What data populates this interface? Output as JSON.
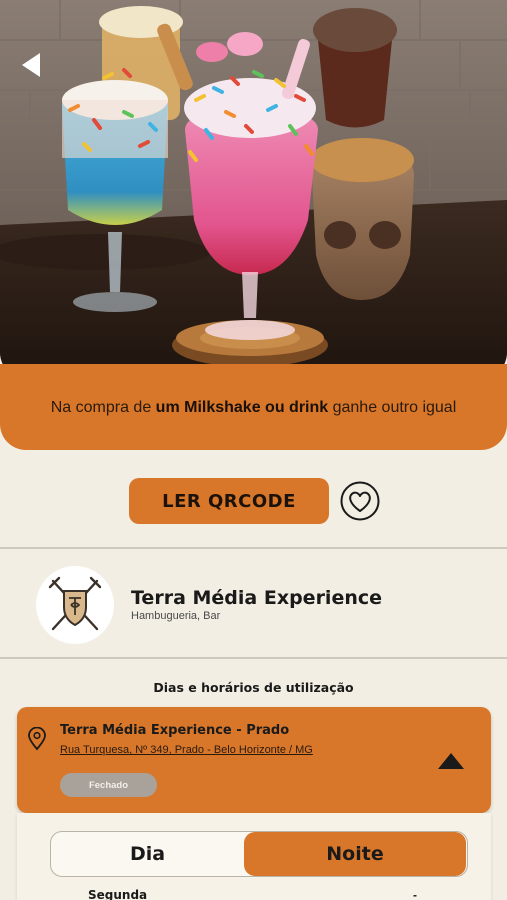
{
  "colors": {
    "accent": "#d8772a",
    "background": "#f3eee3",
    "status_closed": "#a8a29a"
  },
  "hero": {
    "back_icon": "back-arrow-icon"
  },
  "promo": {
    "prefix": "Na compra de ",
    "bold": "um Milkshake ou drink",
    "suffix": " ganhe outro igual"
  },
  "actions": {
    "qr_label": "LER QRCODE",
    "favorite_icon": "heart-icon"
  },
  "venue": {
    "name": "Terra Média Experience",
    "categories": "Hambugueria, Bar",
    "logo_icon": "crossed-swords-shield-logo"
  },
  "schedule": {
    "section_title": "Dias e horários de utilização",
    "location": {
      "title": "Terra Média Experience - Prado",
      "address": "Rua Turquesa, Nº 349, Prado - Belo Horizonte / MG",
      "status": "Fechado",
      "pin_icon": "map-pin-icon",
      "toggle_icon": "triangle-up-icon"
    },
    "tabs": [
      {
        "label": "Dia",
        "selected": false
      },
      {
        "label": "Noite",
        "selected": true
      }
    ],
    "rows": [
      {
        "day": "Segunda",
        "hours": "-"
      }
    ]
  }
}
